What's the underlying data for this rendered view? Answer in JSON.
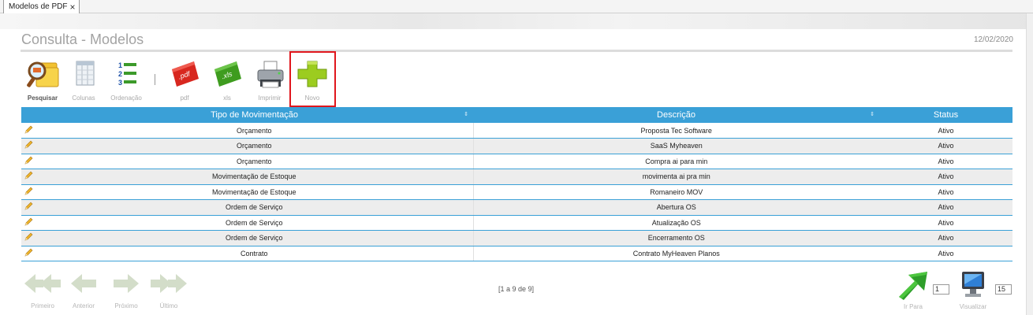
{
  "tab": {
    "label": "Modelos de PDF",
    "close": "×"
  },
  "page": {
    "title": "Consulta - Modelos",
    "date": "12/02/2020"
  },
  "toolbar": {
    "items": [
      {
        "label": "Pesquisar",
        "icon": "search-folder-icon"
      },
      {
        "label": "Colunas",
        "icon": "columns-icon"
      },
      {
        "label": "Ordenação",
        "icon": "ordered-list-icon"
      },
      {
        "label": "pdf",
        "icon": "pdf-icon"
      },
      {
        "label": "xls",
        "icon": "xls-icon"
      },
      {
        "label": "Imprimir",
        "icon": "printer-icon"
      },
      {
        "label": "Novo",
        "icon": "plus-icon"
      }
    ]
  },
  "table": {
    "headers": [
      "Tipo de Movimentação",
      "Descrição",
      "Status"
    ],
    "sort_glyph": "⇕",
    "rows": [
      {
        "tipo": "Orçamento",
        "descricao": "Proposta Tec Software",
        "status": "Ativo"
      },
      {
        "tipo": "Orçamento",
        "descricao": "SaaS Myheaven",
        "status": "Ativo"
      },
      {
        "tipo": "Orçamento",
        "descricao": "Compra ai para min",
        "status": "Ativo"
      },
      {
        "tipo": "Movimentação de Estoque",
        "descricao": "movimenta ai pra min",
        "status": "Ativo"
      },
      {
        "tipo": "Movimentação de Estoque",
        "descricao": "Romaneiro MOV",
        "status": "Ativo"
      },
      {
        "tipo": "Ordem de Serviço",
        "descricao": "Abertura OS",
        "status": "Ativo"
      },
      {
        "tipo": "Ordem de Serviço",
        "descricao": "Atualização OS",
        "status": "Ativo"
      },
      {
        "tipo": "Ordem de Serviço",
        "descricao": "Encerramento OS",
        "status": "Ativo"
      },
      {
        "tipo": "Contrato",
        "descricao": "Contrato MyHeaven Planos",
        "status": "Ativo"
      }
    ]
  },
  "pager": {
    "first": "Primeiro",
    "prev": "Anterior",
    "next": "Próximo",
    "last": "Último",
    "info": "[1 a 9 de 9]",
    "goto_label": "Ir Para",
    "goto_value": "1",
    "view_label": "Visualizar",
    "view_value": "15"
  },
  "colors": {
    "accent": "#3aa0d7",
    "highlight": "#e0161d",
    "plus_green": "#9ccc1f"
  }
}
